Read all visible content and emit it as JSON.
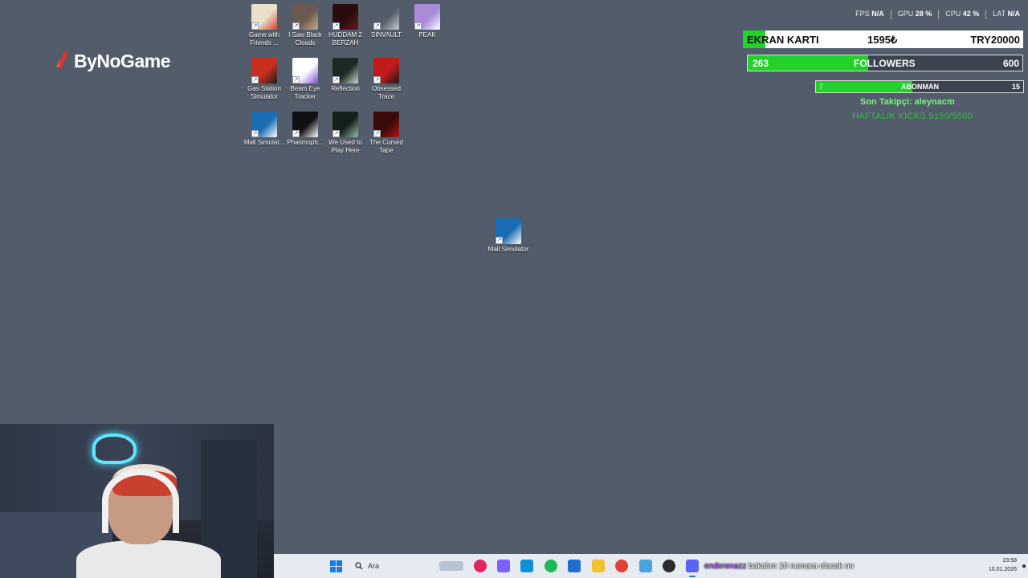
{
  "logo": {
    "text": "ByNoGame"
  },
  "desktop_icons": [
    {
      "label": "Game with Friends ...",
      "color": "#e8e0c8",
      "accent": "#d2432e"
    },
    {
      "label": "I Saw Black Clouds",
      "color": "#6b5a50",
      "accent": "#c9a890"
    },
    {
      "label": "HUDDAM 2 BERZAH",
      "color": "#2a0c0e",
      "accent": "#6a1a1c"
    },
    {
      "label": "SINVAULT",
      "color": "#525c6b",
      "accent": "#c8ccd2"
    },
    {
      "label": "PEAK",
      "color": "#a98bd8",
      "accent": "#ffffff"
    },
    {
      "label": "Gas Station Simulator",
      "color": "#c8301e",
      "accent": "#1b1b1b"
    },
    {
      "label": "Beam Eye Tracker",
      "color": "#ffffff",
      "accent": "#7a4dd1"
    },
    {
      "label": "Reflection",
      "color": "#1c2a24",
      "accent": "#c8d8cf"
    },
    {
      "label": "Obsessed Trace",
      "color": "#c11a1a",
      "accent": "#1a1a1a"
    },
    {
      "label": "Mall Simulat...",
      "color": "#1a6db3",
      "accent": "#ffffff"
    },
    {
      "label": "Phasmoph...",
      "color": "#111111",
      "accent": "#ffffff"
    },
    {
      "label": "We Used to Play Here",
      "color": "#14201c",
      "accent": "#9ab8a4"
    },
    {
      "label": "The Cursed Tape",
      "color": "#3b0a0a",
      "accent": "#b21616"
    },
    {
      "label": "Mall Simulator",
      "color": "#1a6db3",
      "accent": "#ffffff"
    }
  ],
  "stats": {
    "fps_label": "FPS",
    "fps_value": "N/A",
    "gpu_label": "GPU",
    "gpu_value": "28 %",
    "cpu_label": "CPU",
    "cpu_value": "42 %",
    "lat_label": "LAT",
    "lat_value": "N/A"
  },
  "ekran_karti": {
    "label": "EKRAN KARTI",
    "current": "1595₺",
    "target": "TRY20000",
    "progress": 0.08
  },
  "followers": {
    "current": "263",
    "label": "FOLLOWERS",
    "target": "600",
    "progress": 0.438
  },
  "abonman": {
    "current": "7",
    "label": "ABONMAN",
    "target": "15",
    "progress": 0.467
  },
  "son_takipci": "Son Takipçi: aleynacm",
  "haftalik": "HAFTALIK KICKS 5150/5500",
  "taskbar": {
    "search_placeholder": "Ara",
    "chat_user": "enderenazz",
    "chat_message": "bakalım 10 numara olacak mı",
    "time": "23:58",
    "date": "10.01.2026",
    "apps": [
      {
        "name": "music",
        "color": "#e0245e"
      },
      {
        "name": "copilot",
        "color": "#7b61ff"
      },
      {
        "name": "edge",
        "color": "#0f8fd6"
      },
      {
        "name": "spotify",
        "color": "#1db954"
      },
      {
        "name": "store",
        "color": "#1f6fd1"
      },
      {
        "name": "explorer",
        "color": "#f2c230"
      },
      {
        "name": "chrome",
        "color": "#e34133"
      },
      {
        "name": "settings",
        "color": "#4aa3df"
      },
      {
        "name": "obs",
        "color": "#2b2b2b"
      },
      {
        "name": "discord",
        "color": "#5865f2"
      }
    ]
  }
}
